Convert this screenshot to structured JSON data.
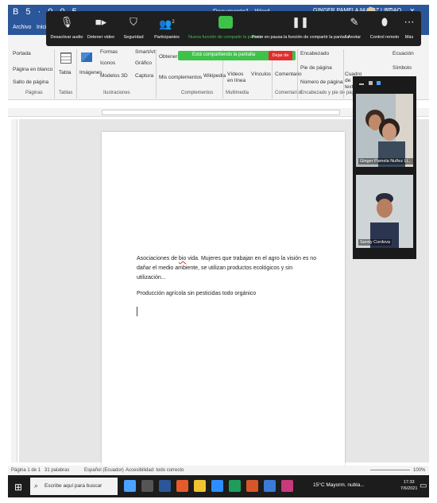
{
  "titlebar": {
    "qat_icons": "B 5 · 0 0 5",
    "doc_title": "Documento1 - Word",
    "user_name": "GINGER PAMELA NUÑEZ LINDAO",
    "window_controls": "— □ ×"
  },
  "tabs": [
    "Archivo",
    "Inicio"
  ],
  "zoom_toolbar": {
    "buttons": [
      {
        "name": "mute",
        "label": "Desactivar audio",
        "icon": "microphone-icon"
      },
      {
        "name": "stop-video",
        "label": "Detener video",
        "icon": "video-camera-icon"
      },
      {
        "name": "security",
        "label": "Seguridad",
        "icon": "shield-icon"
      },
      {
        "name": "participants",
        "label": "Participantes",
        "icon": "people-icon",
        "count": "2"
      },
      {
        "name": "new-share",
        "label": "Nueva función de compartir la pantalla",
        "icon": "share-screen-icon"
      },
      {
        "name": "pause-share",
        "label": "Poner en pausa la función de compartir la pantalla",
        "icon": "pause-icon"
      },
      {
        "name": "annotate",
        "label": "Anotar",
        "icon": "pen-icon"
      },
      {
        "name": "remote-control",
        "label": "Control remoto",
        "icon": "mouse-icon"
      },
      {
        "name": "more",
        "label": "Más",
        "icon": "more-icon"
      }
    ]
  },
  "share_banner": {
    "text": "Está compartiendo la pantalla",
    "stop_label": "Dejar de"
  },
  "ribbon": {
    "paginas": {
      "items": [
        "Portada",
        "Página en blanco",
        "Salto de página"
      ],
      "label": "Páginas"
    },
    "tablas": {
      "item": "Tabla",
      "label": "Tablas"
    },
    "ilustraciones": {
      "items": [
        "Imágenes",
        "Formas",
        "Iconos",
        "Modelos 3D",
        "SmartArt",
        "Gráfico",
        "Captura"
      ],
      "label": "Ilustraciones"
    },
    "complementos": {
      "items": [
        "Obtener",
        "Mis complementos",
        "Wikipedia"
      ],
      "label": "Complementos"
    },
    "multimedia": {
      "item": "Vídeos en línea",
      "label": "Multimedia"
    },
    "vinculos": {
      "item": "Vínculos"
    },
    "comentarios": {
      "item": "Comentario",
      "label": "Comentarios"
    },
    "encabezado": {
      "items": [
        "Encabezado",
        "Pie de página",
        "Número de página"
      ],
      "label": "Encabezado y pie de página"
    },
    "texto": {
      "items": [
        "Cuadro de texto"
      ]
    },
    "simbolos": {
      "items": [
        "Ecuación",
        "Símbolo"
      ]
    }
  },
  "document": {
    "paragraph1_before": "Asociaciones de ",
    "paragraph1_squiggle": "bio",
    "paragraph1_after": " vida. Mujeres que trabajan en el agro la visión es no dañar el medio ambiente, se utilizan productos ecológicos y sin utilización...",
    "paragraph2": "Producción agrícola sin pesticidas todo orgánico"
  },
  "video_panel": {
    "participants": [
      {
        "name": "Ginger Pamela Nuñez Li..."
      },
      {
        "name": "Sandy Cordova"
      }
    ]
  },
  "status_bar": {
    "page": "Página 1 de 1",
    "words": "31 palabras",
    "language": "Español (Ecuador)",
    "accessibility": "Accesibilidad: todo correcto",
    "zoom": "100%"
  },
  "taskbar": {
    "search_placeholder": "Escribe aquí para buscar",
    "weather": "15°C Mayorm. nubla...",
    "time": "17:33",
    "date": "7/6/2021"
  },
  "colors": {
    "word_blue": "#2b579a",
    "zoom_green": "#3fc24a",
    "stop_red": "#e02e2e",
    "taskbar": "#1c1c1c"
  }
}
